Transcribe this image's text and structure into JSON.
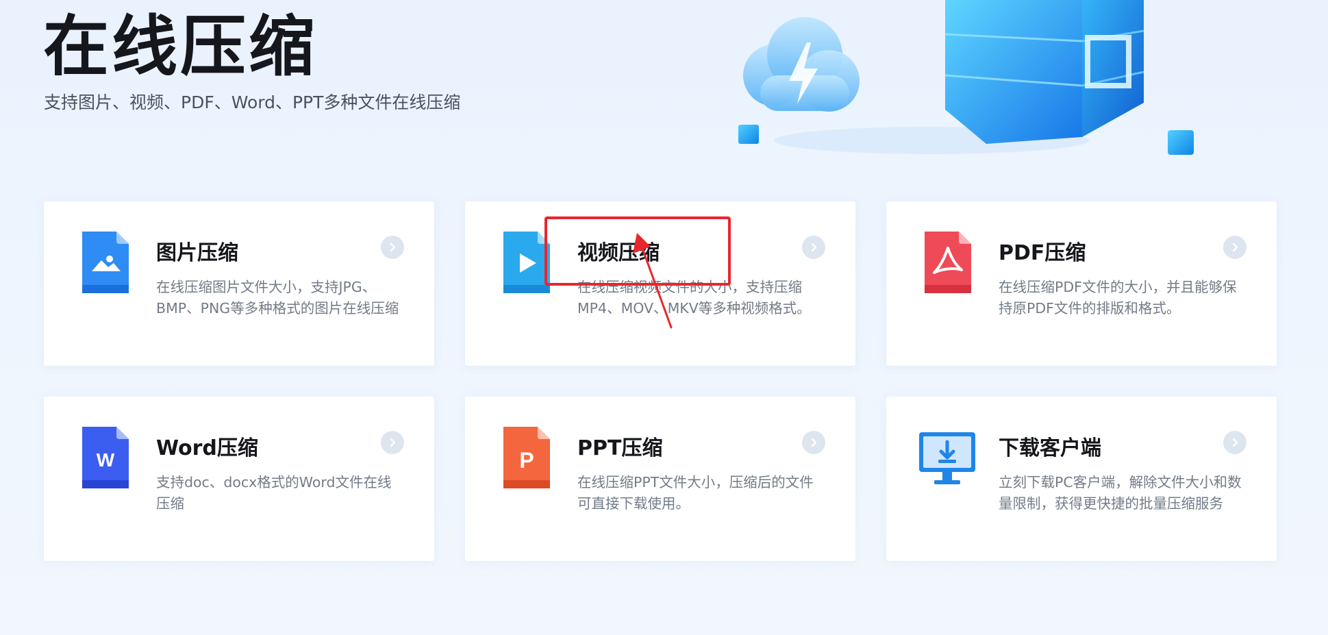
{
  "hero": {
    "title": "在线压缩",
    "subtitle": "支持图片、视频、PDF、Word、PPT多种文件在线压缩"
  },
  "cards": [
    {
      "title": "图片压缩",
      "desc": "在线压缩图片文件大小，支持JPG、BMP、PNG等多种格式的图片在线压缩",
      "icon": "image-file-icon"
    },
    {
      "title": "视频压缩",
      "desc": "在线压缩视频文件的大小，支持压缩MP4、MOV、MKV等多种视频格式。",
      "icon": "video-file-icon"
    },
    {
      "title": "PDF压缩",
      "desc": "在线压缩PDF文件的大小，并且能够保持原PDF文件的排版和格式。",
      "icon": "pdf-file-icon"
    },
    {
      "title": "Word压缩",
      "desc": "支持doc、docx格式的Word文件在线压缩",
      "icon": "word-file-icon",
      "glyph": "W"
    },
    {
      "title": "PPT压缩",
      "desc": "在线压缩PPT文件大小，压缩后的文件可直接下载使用。",
      "icon": "ppt-file-icon",
      "glyph": "P"
    },
    {
      "title": "下载客户端",
      "desc": "立刻下载PC客户端，解除文件大小和数量限制，获得更快捷的批量压缩服务",
      "icon": "monitor-download-icon"
    }
  ],
  "colors": {
    "image": "#2f8cf4",
    "video": "#2aa9ee",
    "pdf": "#ef4a57",
    "word": "#3b5ef0",
    "ppt": "#f4663e",
    "client": "#1f86e8",
    "highlight": "#e8262d"
  }
}
